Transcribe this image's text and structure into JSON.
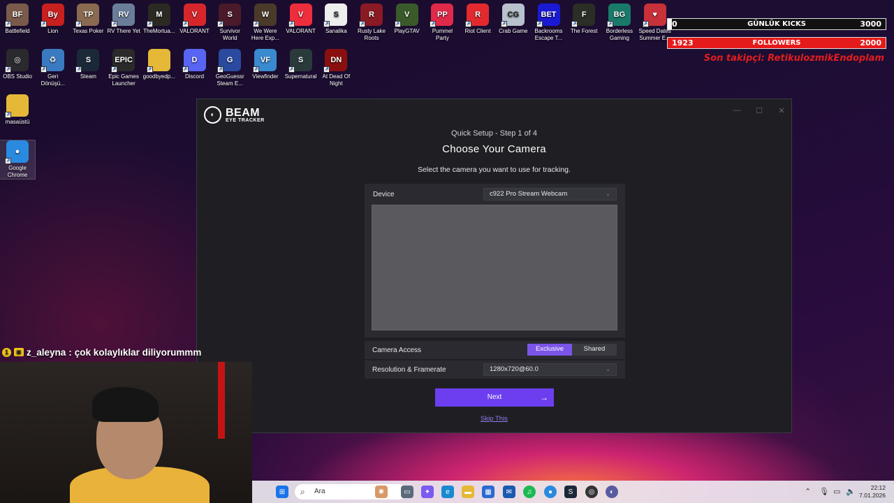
{
  "desktop": {
    "row1": [
      {
        "label": "Battlefield",
        "color": "#7a5a4a",
        "glyph": "BF"
      },
      {
        "label": "Lion",
        "color": "#c8201e",
        "glyph": "By"
      },
      {
        "label": "Texas Poker",
        "color": "#8a6a50",
        "glyph": "TP"
      },
      {
        "label": "RV There Yet",
        "color": "#6a7e9a",
        "glyph": "RV"
      },
      {
        "label": "TheMortua...",
        "color": "#2a2a22",
        "glyph": "M"
      },
      {
        "label": "VALORANT",
        "color": "#d6262c",
        "glyph": "V"
      },
      {
        "label": "Survivor World",
        "color": "#4a1a2a",
        "glyph": "S"
      },
      {
        "label": "We Were Here Exp...",
        "color": "#4a3a2a",
        "glyph": "W"
      },
      {
        "label": "VALORANT",
        "color": "#ee2d3d",
        "glyph": "V"
      },
      {
        "label": "Sanalika",
        "color": "#eeeeee",
        "glyph": "S"
      },
      {
        "label": "Rusty Lake Roots",
        "color": "#8a1a24",
        "glyph": "R"
      },
      {
        "label": "PlayGTAV",
        "color": "#3a5a2a",
        "glyph": "V"
      },
      {
        "label": "Pummel Party",
        "color": "#e02a4a",
        "glyph": "PP"
      },
      {
        "label": "Riot Client",
        "color": "#e22a2e",
        "glyph": "R"
      },
      {
        "label": "Crab Game",
        "color": "#b7c2cc",
        "glyph": "CG"
      },
      {
        "label": "Backrooms Escape T...",
        "color": "#1a1ad4",
        "glyph": "BET"
      },
      {
        "label": "The Forest",
        "color": "#2a2e24",
        "glyph": "F"
      },
      {
        "label": "Borderless Gaming",
        "color": "#1a7a6a",
        "glyph": "BG"
      },
      {
        "label": "Speed Dates Summer E...",
        "color": "#c8303a",
        "glyph": "♥"
      }
    ],
    "row2": [
      {
        "label": "OBS Studio",
        "color": "#2a2a2e",
        "glyph": "◎"
      },
      {
        "label": "Geri Dönüşü...",
        "color": "#3a7ac0",
        "glyph": "♻"
      },
      {
        "label": "Steam",
        "color": "#1b2838",
        "glyph": "S"
      },
      {
        "label": "Epic Games Launcher",
        "color": "#2a2a2a",
        "glyph": "EPIC"
      },
      {
        "label": "goodbyedp...",
        "color": "#e6b838",
        "glyph": ""
      },
      {
        "label": "Discord",
        "color": "#5865f2",
        "glyph": "D"
      },
      {
        "label": "GeoGuessr Steam E...",
        "color": "#2a4aa0",
        "glyph": "G"
      },
      {
        "label": "Viewfinder",
        "color": "#3a8ad0",
        "glyph": "VF"
      },
      {
        "label": "Supernatural",
        "color": "#2a3a3a",
        "glyph": "S"
      },
      {
        "label": "At Dead Of Night",
        "color": "#8a1010",
        "glyph": "DN"
      }
    ],
    "col": [
      {
        "label": "masaüstü",
        "color": "#e6b838",
        "glyph": ""
      },
      {
        "label": "Google Chrome",
        "color": "#2a8ae0",
        "glyph": "●"
      }
    ]
  },
  "overlay": {
    "kicks": {
      "left": "0",
      "label": "GÜNLÜK KICKS",
      "right": "3000"
    },
    "followers": {
      "left": "1923",
      "label": "FOLLOWERS",
      "right": "2000"
    },
    "last_follower": "Son takipçi: RetikulozmikEndoplam"
  },
  "beam": {
    "brand": "BEAM",
    "brand_sub": "EYE TRACKER",
    "step": "Quick Setup - Step 1 of 4",
    "title": "Choose Your Camera",
    "subtitle": "Select the camera you want to use for tracking.",
    "device_label": "Device",
    "device_value": "c922 Pro Stream Webcam",
    "access_label": "Camera Access",
    "access_options": [
      "Exclusive",
      "Shared"
    ],
    "access_selected": "Exclusive",
    "res_label": "Resolution & Framerate",
    "res_value": "1280x720@60.0",
    "next_label": "Next",
    "skip_label": "Skip This"
  },
  "chat": {
    "user": "z_aleyna",
    "separator": ":",
    "message": "çok kolaylıklar diliyorummm"
  },
  "taskbar": {
    "search_placeholder": "Ara",
    "time": "22:12",
    "date": "7.01.2026"
  }
}
